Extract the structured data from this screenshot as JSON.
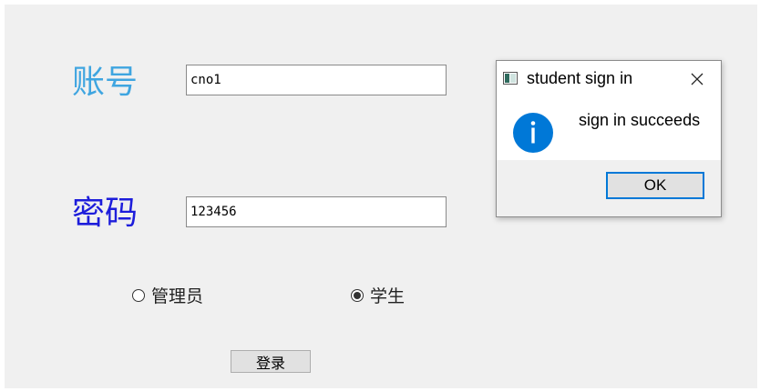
{
  "form": {
    "account_label": "账号",
    "account_value": "cno1",
    "password_label": "密码",
    "password_value": "123456",
    "role_options": [
      {
        "label": "管理员",
        "selected": false
      },
      {
        "label": "学生",
        "selected": true
      }
    ],
    "login_label": "登录"
  },
  "dialog": {
    "title": "student sign in",
    "message": "sign in succeeds",
    "ok_label": "OK",
    "icon": "info-icon"
  },
  "colors": {
    "account_label": "#3fa5e0",
    "password_label": "#1d1ddb",
    "info_icon": "#0078d7",
    "ok_border": "#0078d7"
  }
}
